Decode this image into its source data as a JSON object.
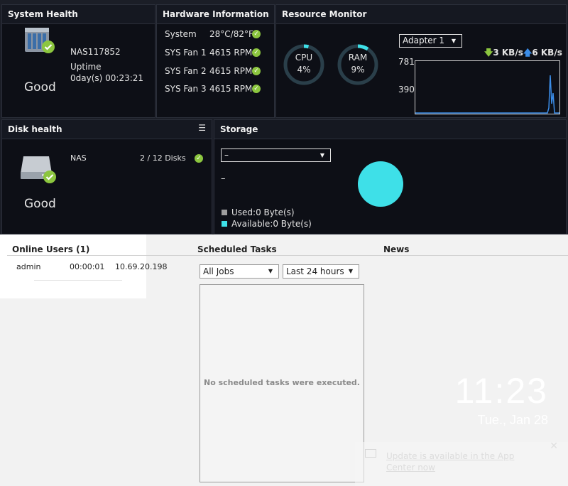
{
  "system_health": {
    "title": "System Health",
    "device_name": "NAS117852",
    "uptime_label": "Uptime",
    "uptime_value": "0day(s) 00:23:21",
    "status": "Good"
  },
  "hardware_info": {
    "title": "Hardware Information",
    "rows": [
      {
        "label": "System",
        "value": "28°C/82°F"
      },
      {
        "label": "SYS Fan 1",
        "value": "4615 RPM"
      },
      {
        "label": "SYS Fan 2",
        "value": "4615 RPM"
      },
      {
        "label": "SYS Fan 3",
        "value": "4615 RPM"
      }
    ]
  },
  "resource_monitor": {
    "title": "Resource Monitor",
    "cpu_label": "CPU",
    "cpu_value": "4%",
    "cpu_fraction": 0.04,
    "ram_label": "RAM",
    "ram_value": "9%",
    "ram_fraction": 0.09,
    "adapter": "Adapter 1",
    "download": "3 KB/s",
    "upload": "6 KB/s",
    "y_max": "781",
    "y_mid": "390"
  },
  "disk_health": {
    "title": "Disk health",
    "name": "NAS",
    "disks": "2 / 12 Disks",
    "status": "Good"
  },
  "storage": {
    "title": "Storage",
    "selected": "–",
    "volume_label": "–",
    "used": "Used:0 Byte(s)",
    "available": "Available:0 Byte(s)"
  },
  "online_users": {
    "title": "Online Users (1)",
    "rows": [
      {
        "user": "admin",
        "duration": "00:00:01",
        "ip": "10.69.20.198"
      }
    ]
  },
  "scheduled_tasks": {
    "title": "Scheduled Tasks",
    "filter": "All Jobs",
    "range": "Last 24 hours",
    "empty": "No scheduled tasks were executed."
  },
  "news": {
    "title": "News"
  },
  "clock": {
    "time": "11:23",
    "date": "Tue., Jan 28"
  },
  "notification": {
    "text": "Update is available in the App Center now"
  },
  "colors": {
    "good": "#8cc63f",
    "accent": "#3ee0e8"
  }
}
